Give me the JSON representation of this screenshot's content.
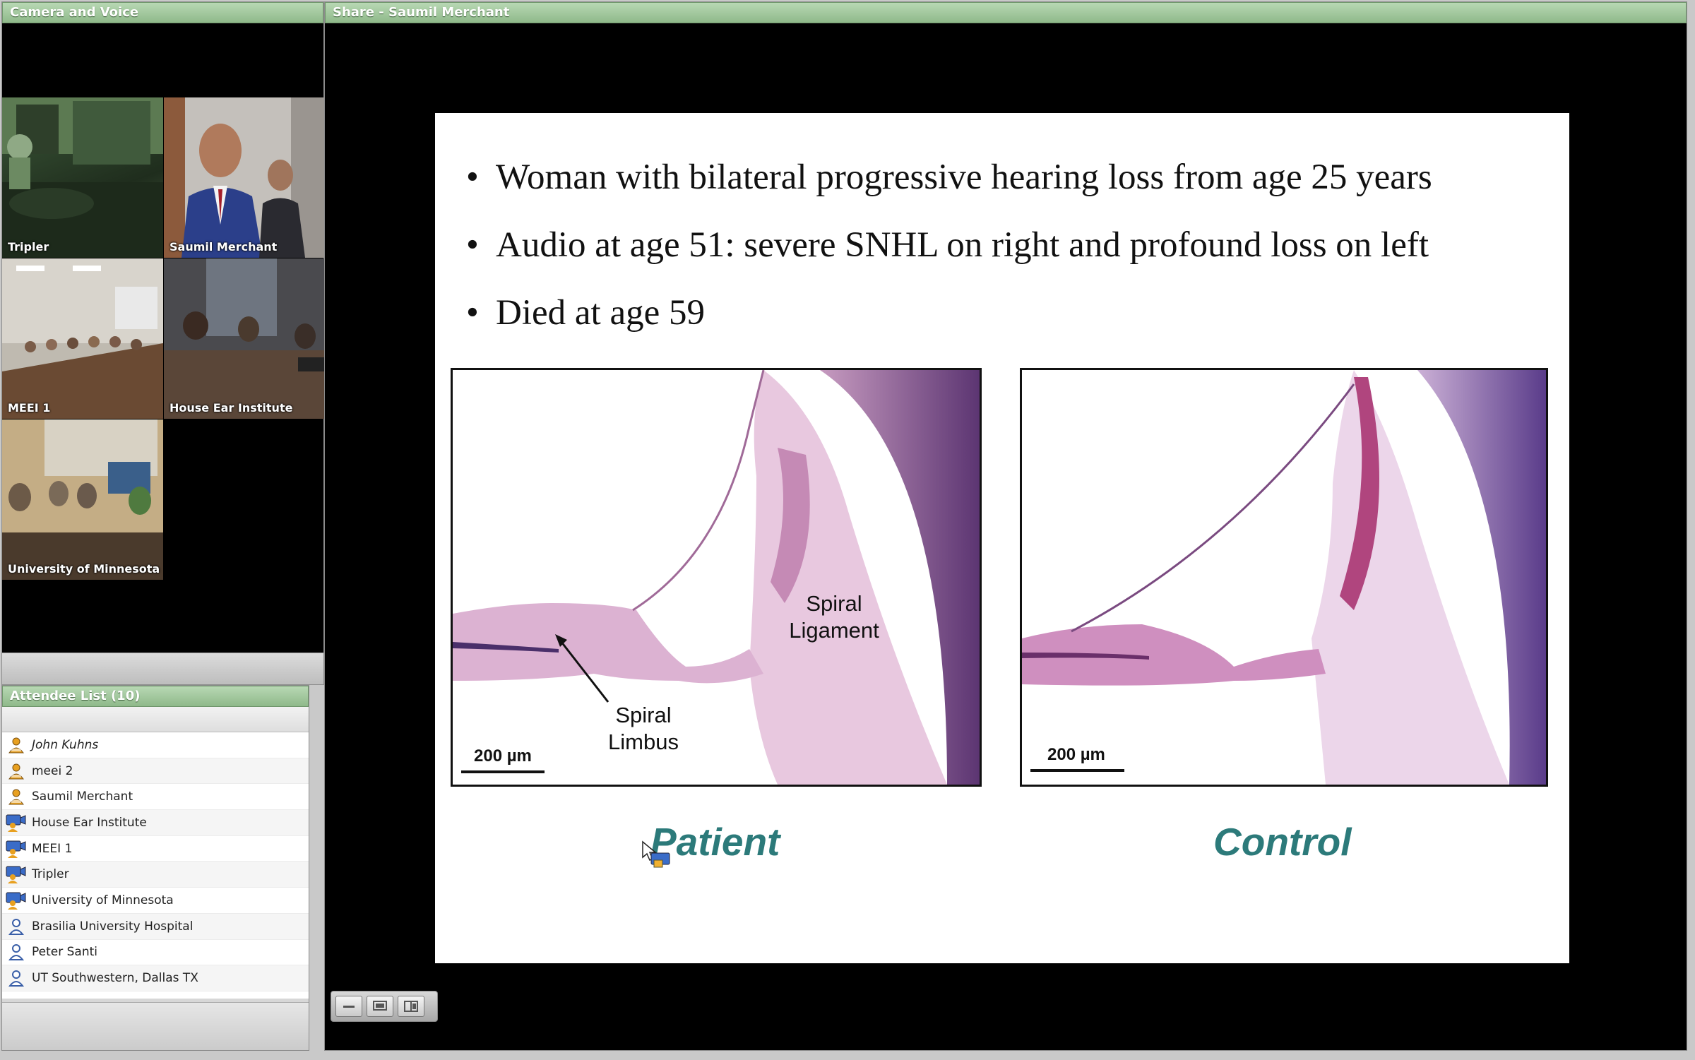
{
  "camera_panel": {
    "title": "Camera and Voice",
    "tiles": [
      {
        "caption": "Tripler"
      },
      {
        "caption": "Saumil Merchant"
      },
      {
        "caption": "MEEI 1"
      },
      {
        "caption": "House Ear Institute"
      },
      {
        "caption": "University of Minnesota"
      }
    ]
  },
  "attendee_panel": {
    "title": "Attendee List (10)",
    "attendees": [
      {
        "name": "John Kuhns",
        "icon": "host-user-icon"
      },
      {
        "name": "meei 2",
        "icon": "host-user-icon"
      },
      {
        "name": "Saumil Merchant",
        "icon": "host-user-icon"
      },
      {
        "name": "House Ear Institute",
        "icon": "video-user-icon"
      },
      {
        "name": "MEEI 1",
        "icon": "video-user-icon"
      },
      {
        "name": "Tripler",
        "icon": "video-user-icon"
      },
      {
        "name": "University of Minnesota",
        "icon": "video-user-icon"
      },
      {
        "name": "Brasilia University Hospital",
        "icon": "user-icon"
      },
      {
        "name": "Peter Santi",
        "icon": "user-icon"
      },
      {
        "name": "UT Southwestern, Dallas TX",
        "icon": "user-icon"
      }
    ]
  },
  "share_panel": {
    "title": "Share - Saumil Merchant"
  },
  "slide": {
    "bullets": [
      "Woman with bilateral progressive hearing loss from age 25 years",
      "Audio at age 51: severe SNHL on right and profound loss on left",
      "Died at age 59"
    ],
    "patient_image": {
      "label_ligament": "Spiral Ligament",
      "label_limbus": "Spiral Limbus",
      "scale": "200 µm",
      "caption": "Patient"
    },
    "control_image": {
      "scale": "200 µm",
      "caption": "Control"
    }
  },
  "colors": {
    "title_bar": "#8fb98a",
    "caption_teal": "#2c7a7a",
    "stain_pink": "#d9a9cc",
    "stain_purple": "#6b3f7f"
  }
}
